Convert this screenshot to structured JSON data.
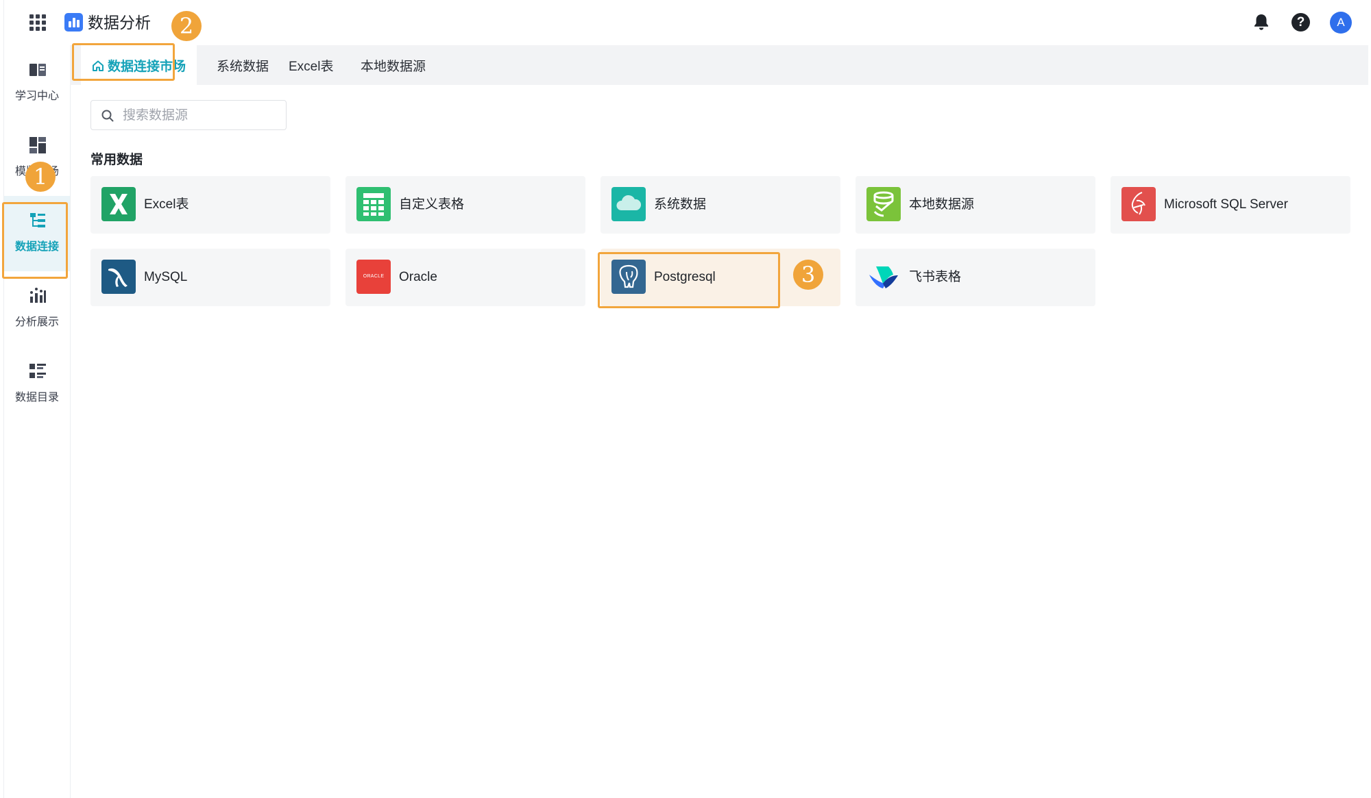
{
  "header": {
    "app_title": "数据分析",
    "avatar_letter": "A",
    "help_glyph": "?"
  },
  "sidebar": {
    "items": [
      {
        "label": "学习中心",
        "icon": "book-icon"
      },
      {
        "label": "模版市场",
        "icon": "template-icon"
      },
      {
        "label": "数据连接",
        "icon": "data-connect-icon",
        "active": true
      },
      {
        "label": "分析展示",
        "icon": "chart-icon"
      },
      {
        "label": "数据目录",
        "icon": "catalog-icon"
      }
    ]
  },
  "tabs": [
    {
      "label": "数据连接市场",
      "active": true
    },
    {
      "label": "系统数据"
    },
    {
      "label": "Excel表"
    },
    {
      "label": "本地数据源"
    }
  ],
  "search": {
    "placeholder": "搜索数据源",
    "value": ""
  },
  "section": {
    "title": "常用数据"
  },
  "sources": [
    {
      "label": "Excel表",
      "icon": "excel-icon"
    },
    {
      "label": "自定义表格",
      "icon": "custom-table-icon"
    },
    {
      "label": "系统数据",
      "icon": "cloud-icon"
    },
    {
      "label": "本地数据源",
      "icon": "local-source-icon"
    },
    {
      "label": "Microsoft SQL Server",
      "icon": "sqlserver-icon"
    },
    {
      "label": "MySQL",
      "icon": "mysql-icon"
    },
    {
      "label": "Oracle",
      "icon": "oracle-icon",
      "icon_text": "ORACLE"
    },
    {
      "label": "Postgresql",
      "icon": "postgresql-icon",
      "selected": true
    },
    {
      "label": "飞书表格",
      "icon": "feishu-sheet-icon"
    }
  ],
  "annotations": {
    "step1": "1",
    "step2": "2",
    "step3": "3"
  },
  "colors": {
    "accent": "#15a2b8",
    "highlight": "#f2a53c",
    "badge": "#f0a43a"
  }
}
